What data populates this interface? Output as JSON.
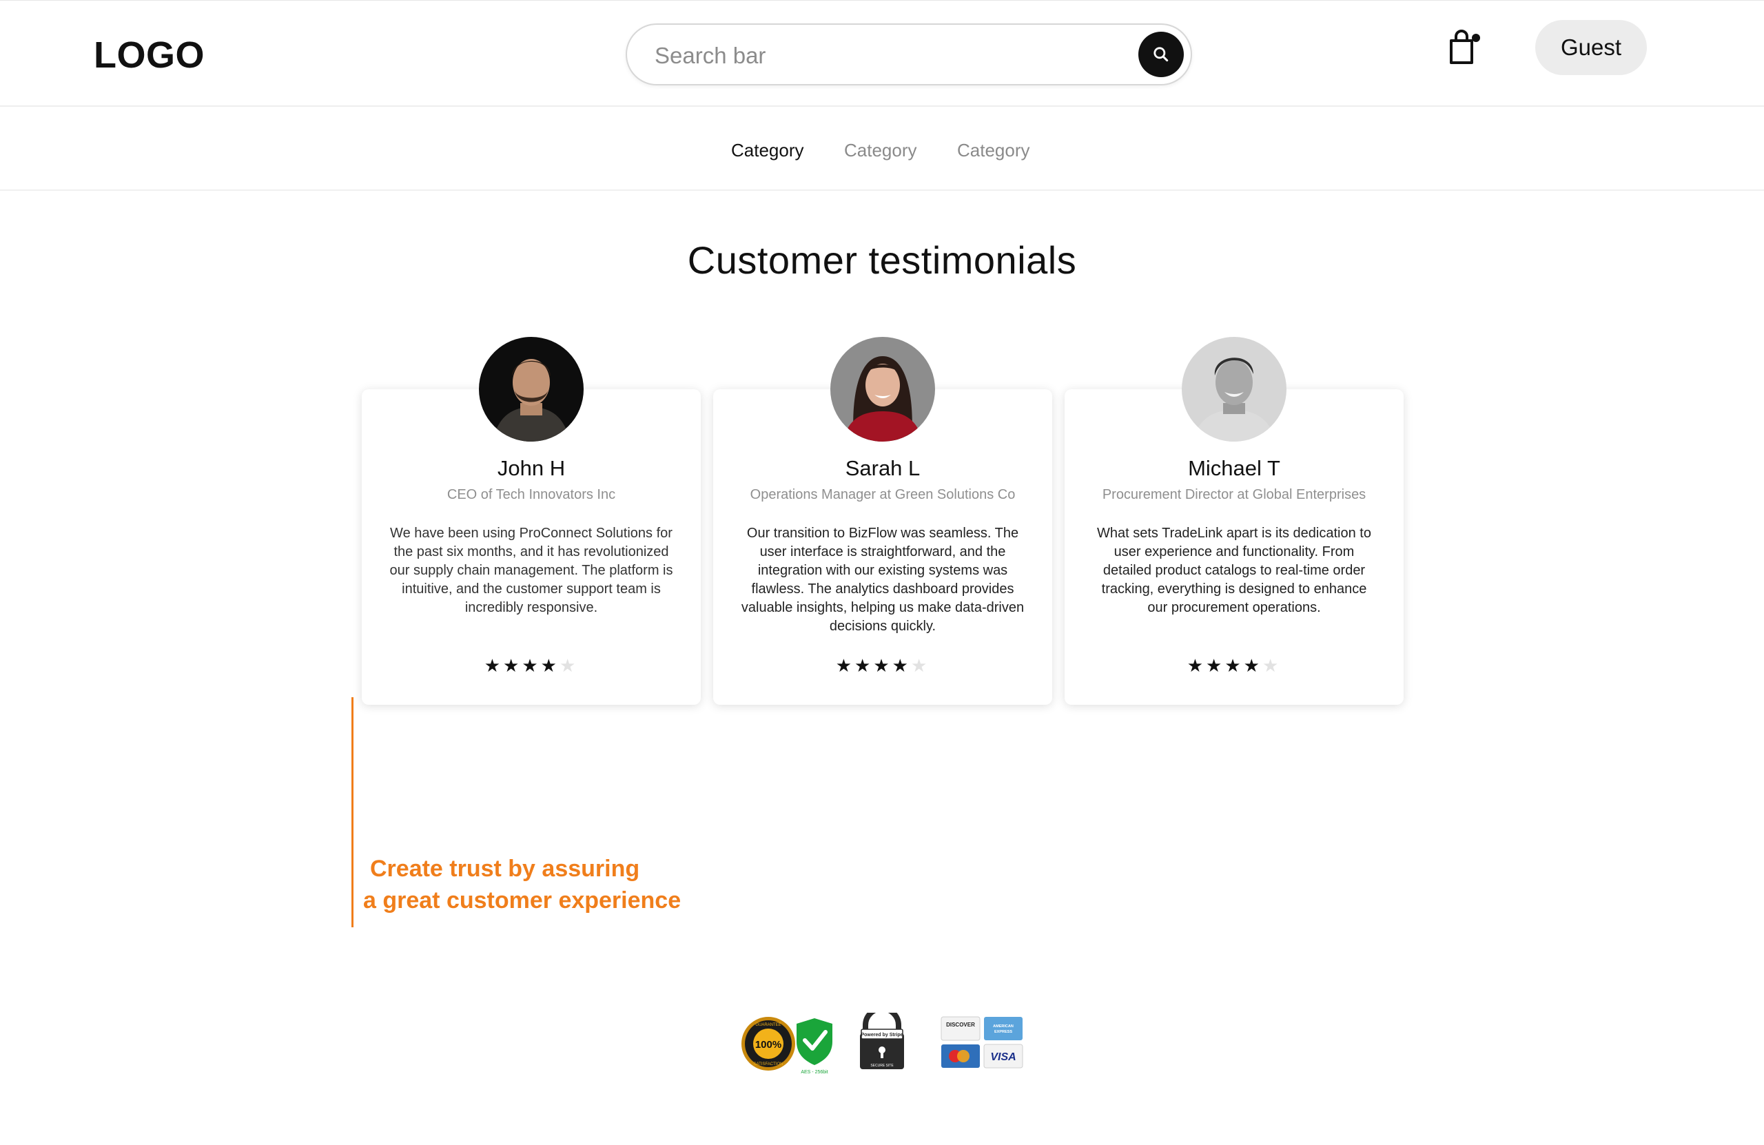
{
  "header": {
    "logo": "LOGO",
    "search_placeholder": "Search bar",
    "guest_label": "Guest"
  },
  "categories": [
    {
      "label": "Category",
      "active": true
    },
    {
      "label": "Category",
      "active": false
    },
    {
      "label": "Category",
      "active": false
    }
  ],
  "section_title": "Customer testimonials",
  "testimonials": [
    {
      "name": "John H",
      "role": "CEO of Tech Innovators Inc",
      "quote": "We have been using ProConnect Solutions for the past six months, and it has revolutionized our supply chain management. The platform is intuitive, and the customer support team is incredibly responsive.",
      "rating": 4,
      "max_rating": 5
    },
    {
      "name": "Sarah L",
      "role": "Operations Manager at Green Solutions Co",
      "quote": "Our transition to BizFlow was seamless. The user interface is straightforward, and the integration with our existing systems was flawless. The analytics dashboard provides valuable insights, helping us make data-driven decisions quickly.",
      "rating": 4,
      "max_rating": 5
    },
    {
      "name": "Michael T",
      "role": "Procurement Director at Global Enterprises",
      "quote": "What sets TradeLink apart is its dedication to user experience and functionality. From detailed product catalogs to real-time order tracking, everything is designed to enhance our procurement operations.",
      "rating": 4,
      "max_rating": 5
    }
  ],
  "annotation": {
    "line1": "Create trust by assuring",
    "line2": "a great customer experience"
  },
  "badges": {
    "guarantee_text": "100%",
    "guarantee_ring": "GUARANTEE · SATISFACTION",
    "shield_caption": "AES - 256bit",
    "stripe_label": "Powered by Stripe",
    "stripe_caption": "SECURE SITE",
    "cards": [
      "DISCOVER",
      "AMERICAN EXPRESS",
      "MasterCard",
      "VISA"
    ]
  },
  "colors": {
    "accent": "#f07e1b",
    "star_on": "#111111",
    "star_off": "#e2e2e2"
  }
}
